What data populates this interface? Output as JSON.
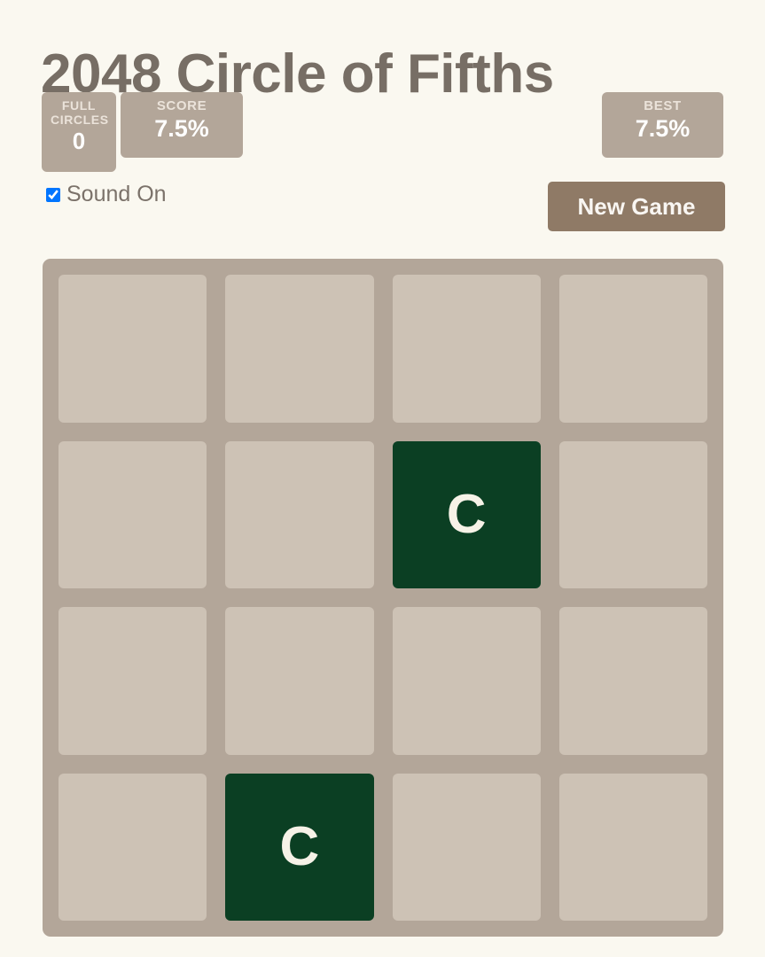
{
  "app": {
    "title": "2048 Circle of Fifths",
    "background_color": "#faf8f0",
    "title_color": "#776e65",
    "accent_color": "#8f7a66",
    "grid_color": "#b3a699",
    "empty_cell_color": "#cdc2b5",
    "tile_color": "#0b3f23",
    "tile_text_color": "#f6f2e7"
  },
  "stats": {
    "full_circles": {
      "label": "FULL CIRCLES",
      "value": "0"
    },
    "score": {
      "label": "SCORE",
      "value": "7.5%"
    },
    "best": {
      "label": "BEST",
      "value": "7.5%"
    }
  },
  "controls": {
    "sound": {
      "label": "Sound On",
      "checked": true
    },
    "new_game": {
      "label": "New Game"
    }
  },
  "board": {
    "rows": 4,
    "columns": 4,
    "cells": [
      [
        {
          "value": ""
        },
        {
          "value": ""
        },
        {
          "value": ""
        },
        {
          "value": ""
        }
      ],
      [
        {
          "value": ""
        },
        {
          "value": ""
        },
        {
          "value": "C"
        },
        {
          "value": ""
        }
      ],
      [
        {
          "value": ""
        },
        {
          "value": ""
        },
        {
          "value": ""
        },
        {
          "value": ""
        }
      ],
      [
        {
          "value": ""
        },
        {
          "value": "C"
        },
        {
          "value": ""
        },
        {
          "value": ""
        }
      ]
    ]
  }
}
